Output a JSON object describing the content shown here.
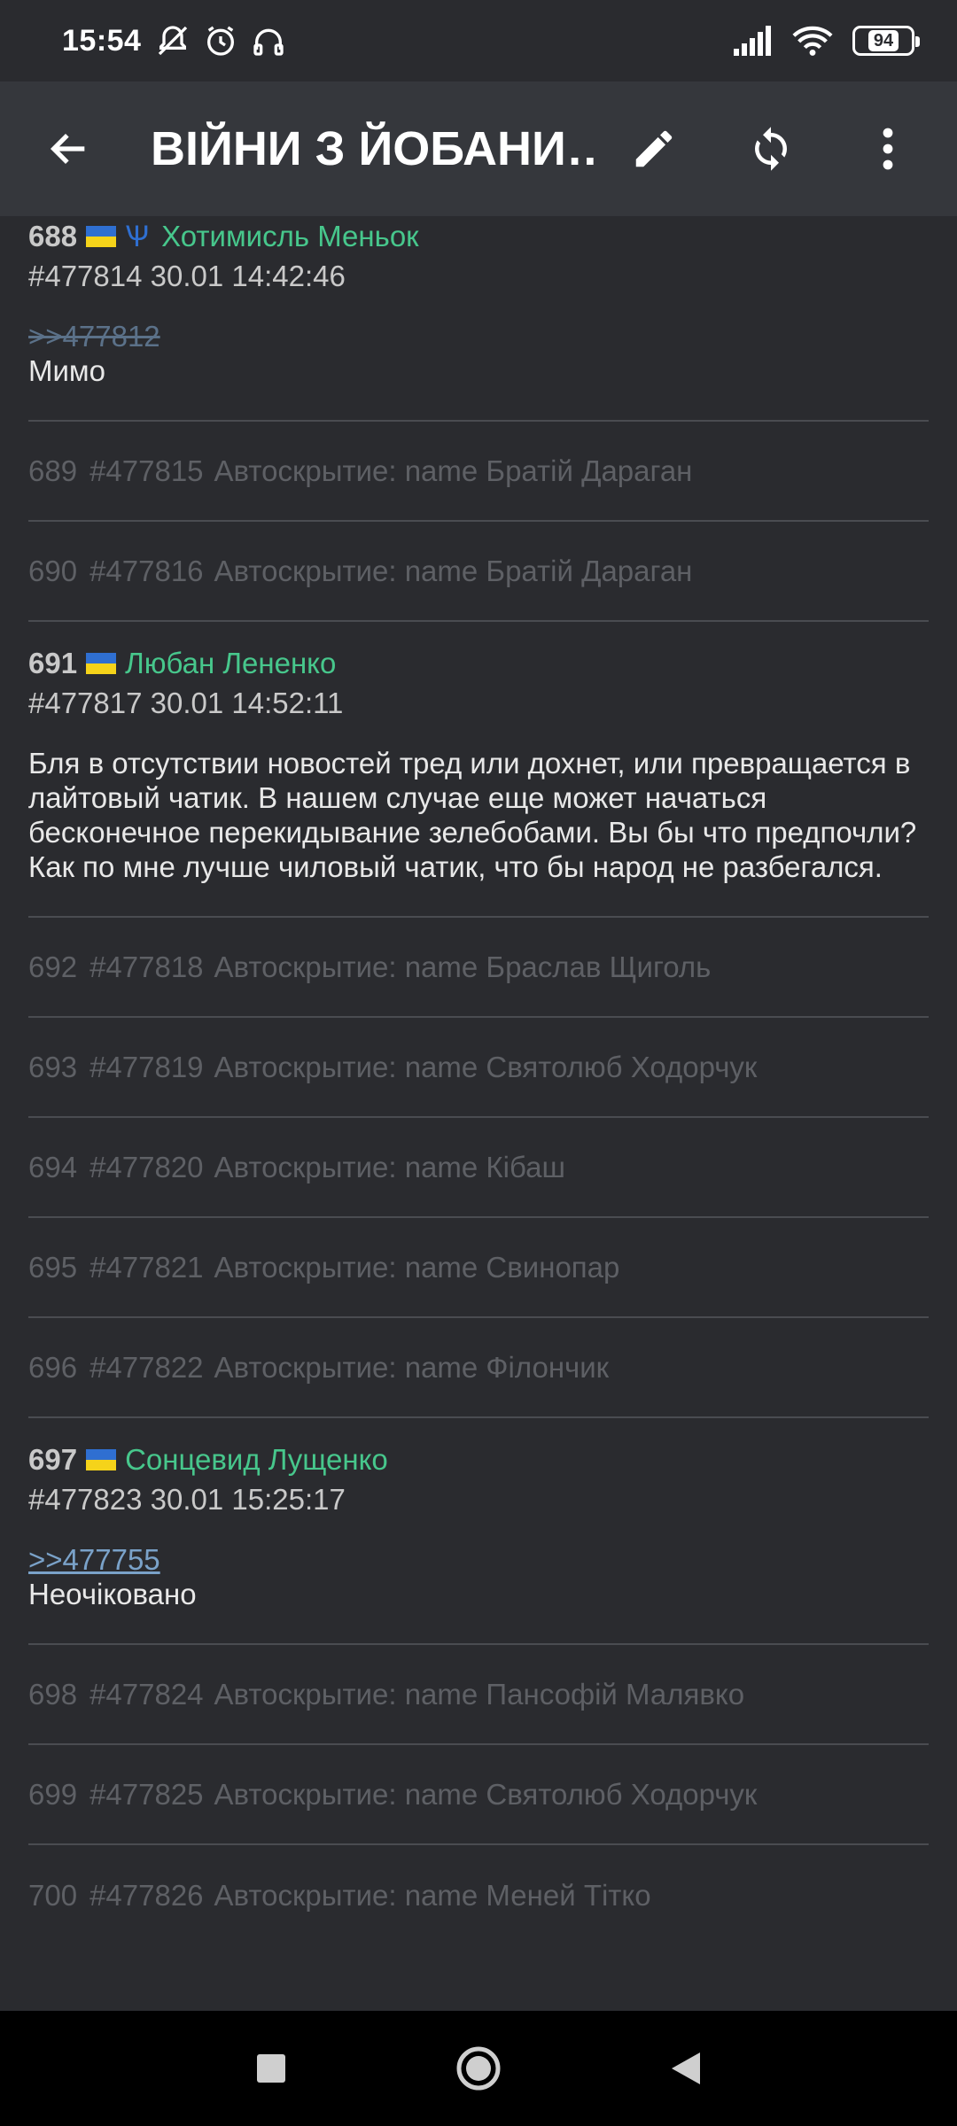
{
  "status": {
    "time": "15:54",
    "battery": "94"
  },
  "appbar": {
    "title": "ВІЙНИ З ЙОБАНИ…"
  },
  "posts": [
    {
      "num": "688",
      "name": "Хотимисль Меньок",
      "meta": "#477814 30.01 14:42:46",
      "reply": ">>477812",
      "text": "Мимо"
    },
    {
      "num": "691",
      "name": "Любан Лененко",
      "meta": "#477817 30.01 14:52:11",
      "text": "Бля в отсутствии новостей тред или дохнет, или превращается в лайтовый чатик. В нашем случае еще может начаться бесконечное перекидывание зелебобами. Вы бы что предпочли? Как по мне лучше чиловый чатик, что бы народ не разбегался."
    },
    {
      "num": "697",
      "name": "Сонцевид Лущенко",
      "meta": "#477823 30.01 15:25:17",
      "reply": ">>477755",
      "text": "Неочіковано"
    }
  ],
  "hidden": [
    {
      "num": "689",
      "id": "#477815",
      "text": "Автоскрытие: name Братій Дараган"
    },
    {
      "num": "690",
      "id": "#477816",
      "text": "Автоскрытие: name Братій Дараган"
    },
    {
      "num": "692",
      "id": "#477818",
      "text": "Автоскрытие: name Браслав Щиголь"
    },
    {
      "num": "693",
      "id": "#477819",
      "text": "Автоскрытие: name Святолюб Ходорчук"
    },
    {
      "num": "694",
      "id": "#477820",
      "text": "Автоскрытие: name Кібаш"
    },
    {
      "num": "695",
      "id": "#477821",
      "text": "Автоскрытие: name Свинопар"
    },
    {
      "num": "696",
      "id": "#477822",
      "text": "Автоскрытие: name Філончик"
    },
    {
      "num": "698",
      "id": "#477824",
      "text": "Автоскрытие: name Пансофій Малявко"
    },
    {
      "num": "699",
      "id": "#477825",
      "text": "Автоскрытие: name Святолюб Ходорчук"
    },
    {
      "num": "700",
      "id": "#477826",
      "text": "Автоскрытие: name Меней Тітко"
    }
  ],
  "colors": {
    "background": "#2a2b2f",
    "appbar": "#35373c",
    "poster_name": "#47c78c",
    "link": "#7aa2c9",
    "hidden_text": "#5e6065"
  },
  "icons": {
    "back": "arrow-left-icon",
    "edit": "pencil-icon",
    "refresh": "refresh-icon",
    "menu": "more-vert-icon"
  }
}
